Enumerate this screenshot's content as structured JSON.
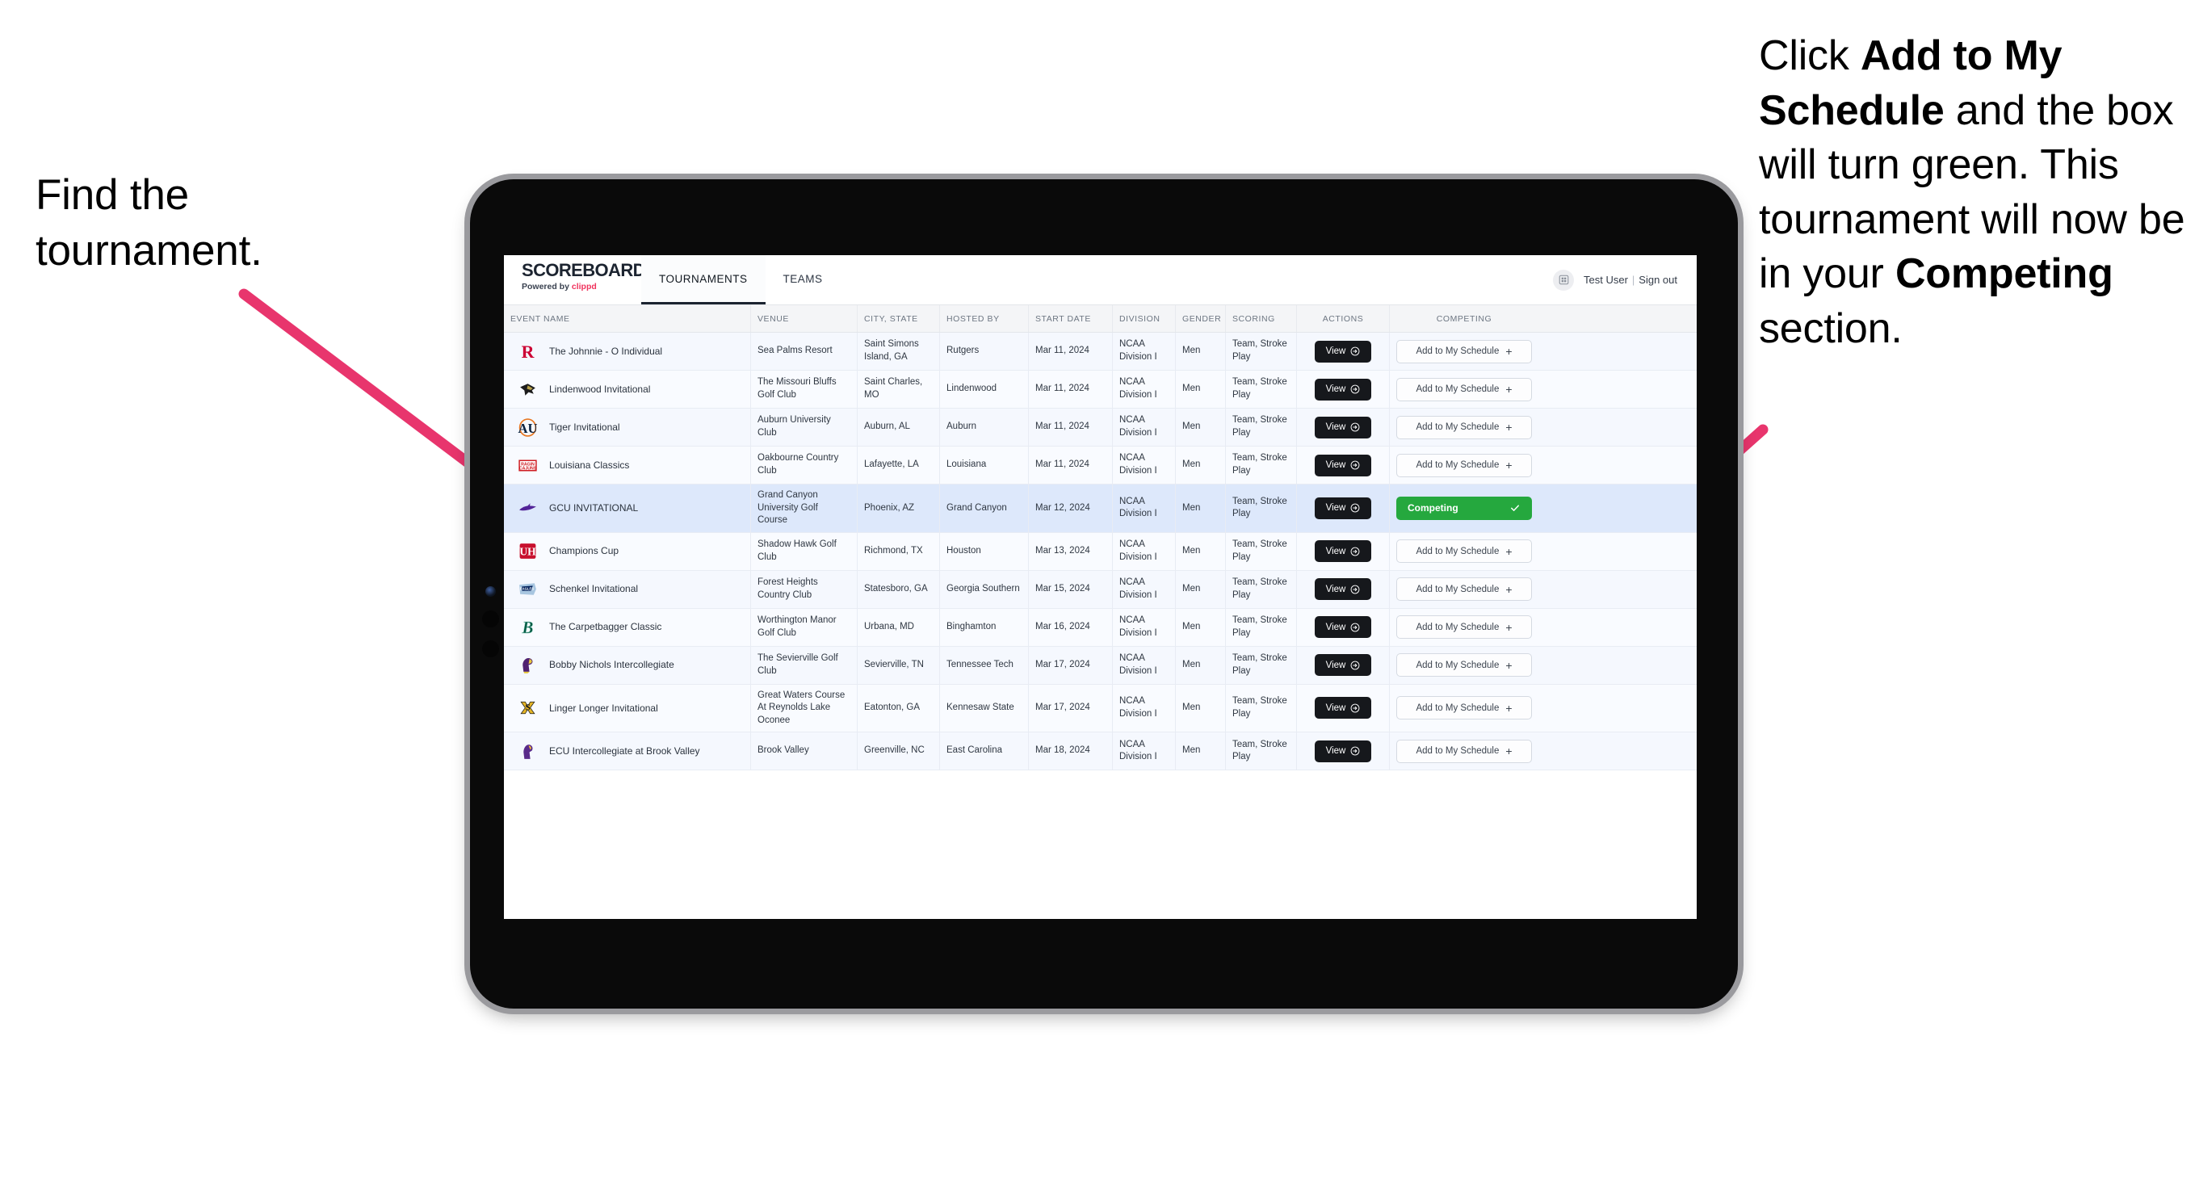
{
  "annotations": {
    "left": "Find the tournament.",
    "right_parts": [
      {
        "t": "Click ",
        "b": false
      },
      {
        "t": "Add to My Schedule",
        "b": true
      },
      {
        "t": " and the box will turn green. This tournament will now be in your ",
        "b": false
      },
      {
        "t": "Competing",
        "b": true
      },
      {
        "t": " section.",
        "b": false
      }
    ],
    "arrow_color": "#E8356D"
  },
  "app": {
    "brand": {
      "title": "SCOREBOARD",
      "powered_prefix": "Powered by ",
      "powered_brand": "clippd"
    },
    "nav": [
      {
        "label": "TOURNAMENTS",
        "active": true
      },
      {
        "label": "TEAMS",
        "active": false
      }
    ],
    "user": {
      "name": "Test User",
      "separator": "|",
      "signout": "Sign out",
      "avatar_icon": "user-grid-icon"
    }
  },
  "table": {
    "columns": [
      "EVENT NAME",
      "VENUE",
      "CITY, STATE",
      "HOSTED BY",
      "START DATE",
      "DIVISION",
      "GENDER",
      "SCORING",
      "ACTIONS",
      "COMPETING"
    ],
    "view_label": "View",
    "add_label": "Add to My Schedule",
    "competing_label": "Competing",
    "rows": [
      {
        "logo": "rutgers",
        "event": "The Johnnie - O Individual",
        "venue": "Sea Palms Resort",
        "city": "Saint Simons Island, GA",
        "host": "Rutgers",
        "date": "Mar 11, 2024",
        "division": "NCAA Division I",
        "gender": "Men",
        "scoring": "Team, Stroke Play",
        "competing": false
      },
      {
        "logo": "lindenwood",
        "event": "Lindenwood Invitational",
        "venue": "The Missouri Bluffs Golf Club",
        "city": "Saint Charles, MO",
        "host": "Lindenwood",
        "date": "Mar 11, 2024",
        "division": "NCAA Division I",
        "gender": "Men",
        "scoring": "Team, Stroke Play",
        "competing": false
      },
      {
        "logo": "auburn",
        "event": "Tiger Invitational",
        "venue": "Auburn University Club",
        "city": "Auburn, AL",
        "host": "Auburn",
        "date": "Mar 11, 2024",
        "division": "NCAA Division I",
        "gender": "Men",
        "scoring": "Team, Stroke Play",
        "competing": false
      },
      {
        "logo": "louisiana",
        "event": "Louisiana Classics",
        "venue": "Oakbourne Country Club",
        "city": "Lafayette, LA",
        "host": "Louisiana",
        "date": "Mar 11, 2024",
        "division": "NCAA Division I",
        "gender": "Men",
        "scoring": "Team, Stroke Play",
        "competing": false
      },
      {
        "logo": "gcu",
        "event": "GCU INVITATIONAL",
        "venue": "Grand Canyon University Golf Course",
        "city": "Phoenix, AZ",
        "host": "Grand Canyon",
        "date": "Mar 12, 2024",
        "division": "NCAA Division I",
        "gender": "Men",
        "scoring": "Team, Stroke Play",
        "competing": true,
        "selected": true
      },
      {
        "logo": "houston",
        "event": "Champions Cup",
        "venue": "Shadow Hawk Golf Club",
        "city": "Richmond, TX",
        "host": "Houston",
        "date": "Mar 13, 2024",
        "division": "NCAA Division I",
        "gender": "Men",
        "scoring": "Team, Stroke Play",
        "competing": false
      },
      {
        "logo": "georgiasouthern",
        "event": "Schenkel Invitational",
        "venue": "Forest Heights Country Club",
        "city": "Statesboro, GA",
        "host": "Georgia Southern",
        "date": "Mar 15, 2024",
        "division": "NCAA Division I",
        "gender": "Men",
        "scoring": "Team, Stroke Play",
        "competing": false
      },
      {
        "logo": "binghamton",
        "event": "The Carpetbagger Classic",
        "venue": "Worthington Manor Golf Club",
        "city": "Urbana, MD",
        "host": "Binghamton",
        "date": "Mar 16, 2024",
        "division": "NCAA Division I",
        "gender": "Men",
        "scoring": "Team, Stroke Play",
        "competing": false
      },
      {
        "logo": "tennesseetech",
        "event": "Bobby Nichols Intercollegiate",
        "venue": "The Sevierville Golf Club",
        "city": "Sevierville, TN",
        "host": "Tennessee Tech",
        "date": "Mar 17, 2024",
        "division": "NCAA Division I",
        "gender": "Men",
        "scoring": "Team, Stroke Play",
        "competing": false
      },
      {
        "logo": "kennesaw",
        "event": "Linger Longer Invitational",
        "venue": "Great Waters Course At Reynolds Lake Oconee",
        "city": "Eatonton, GA",
        "host": "Kennesaw State",
        "date": "Mar 17, 2024",
        "division": "NCAA Division I",
        "gender": "Men",
        "scoring": "Team, Stroke Play",
        "competing": false
      },
      {
        "logo": "eastcarolina",
        "event": "ECU Intercollegiate at Brook Valley",
        "venue": "Brook Valley",
        "city": "Greenville, NC",
        "host": "East Carolina",
        "date": "Mar 18, 2024",
        "division": "NCAA Division I",
        "gender": "Men",
        "scoring": "Team, Stroke Play",
        "competing": false,
        "partial": true
      }
    ]
  }
}
